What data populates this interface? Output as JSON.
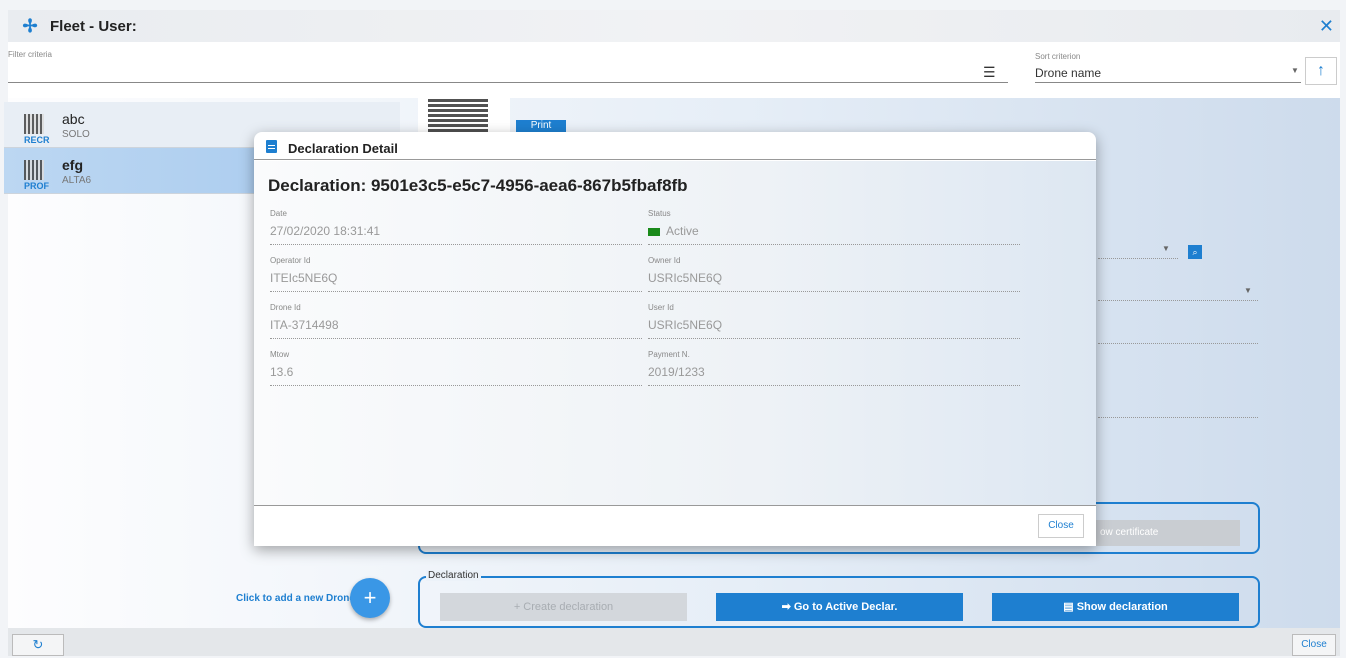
{
  "window": {
    "title": "Fleet - User:",
    "close_glyph": "✕"
  },
  "filter": {
    "label": "Filter criteria",
    "icon": "filter-icon"
  },
  "sort": {
    "label": "Sort criterion",
    "value": "Drone name",
    "direction_glyph": "↑"
  },
  "drones": [
    {
      "name": "abc",
      "model": "SOLO",
      "badge": "RECR"
    },
    {
      "name": "efg",
      "model": "ALTA6",
      "badge": "PROF"
    }
  ],
  "background": {
    "print_label": "Print",
    "cert_label": "ow certificate",
    "declaration_legend": "Declaration",
    "create_label": "+ Create declaration",
    "go_label": "➡ Go to Active Declar.",
    "show_label": "Show declaration"
  },
  "add_drone": {
    "label": "Click to add a new Drone.",
    "glyph": "+"
  },
  "bottom": {
    "refresh_glyph": "↻",
    "close_label": "Close"
  },
  "modal": {
    "title": "Declaration Detail",
    "heading": "Declaration: 9501e3c5-e5c7-4956-aea6-867b5fbaf8fb",
    "fields": {
      "date": {
        "label": "Date",
        "value": "27/02/2020 18:31:41"
      },
      "status": {
        "label": "Status",
        "value": "Active"
      },
      "operator_id": {
        "label": "Operator Id",
        "value": "ITEIc5NE6Q"
      },
      "owner_id": {
        "label": "Owner Id",
        "value": "USRIc5NE6Q"
      },
      "drone_id": {
        "label": "Drone Id",
        "value": "ITA-3714498"
      },
      "user_id": {
        "label": "User Id",
        "value": "USRIc5NE6Q"
      },
      "mtow": {
        "label": "Mtow",
        "value": "13.6"
      },
      "payment": {
        "label": "Payment N.",
        "value": "2019/1233"
      }
    },
    "close_label": "Close"
  },
  "colors": {
    "accent": "#1e7fd0",
    "status_active": "#1a8a1a"
  }
}
